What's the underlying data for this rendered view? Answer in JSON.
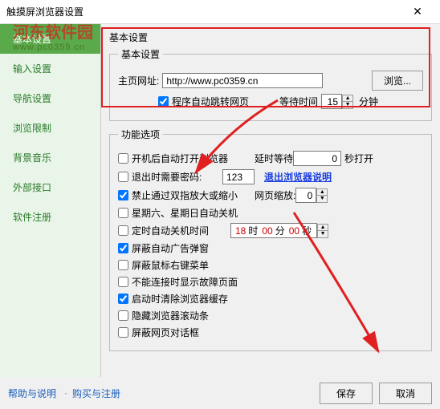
{
  "window": {
    "title": "触摸屏浏览器设置"
  },
  "watermark": {
    "line1": "河东软件园",
    "line2": "www.pc0359.cn"
  },
  "sidebar": {
    "items": [
      {
        "label": "基本设置"
      },
      {
        "label": "输入设置"
      },
      {
        "label": "导航设置"
      },
      {
        "label": "浏览限制"
      },
      {
        "label": "背景音乐"
      },
      {
        "label": "外部接口"
      },
      {
        "label": "软件注册"
      }
    ]
  },
  "basic": {
    "legend_top": "基本设置",
    "legend": "基本设置",
    "homepage_label": "主页网址:",
    "homepage_value": "http://www.pc0359.cn",
    "browse_btn": "浏览...",
    "auto_jump_label": "程序自动跳转网页",
    "auto_jump_checked": true,
    "wait_label": "等待时间",
    "wait_value": "15",
    "wait_unit": "分钟"
  },
  "options": {
    "legend": "功能选项",
    "auto_open": {
      "label": "开机后自动打开浏览器",
      "checked": false
    },
    "delay_label": "延时等待",
    "delay_value": "0",
    "delay_unit": "秒打开",
    "exit_pwd": {
      "label": "退出时需要密码:",
      "checked": false,
      "value": "123"
    },
    "exit_link": "退出浏览器说明",
    "pinch": {
      "label": "禁止通过双指放大或缩小",
      "checked": true
    },
    "zoom_label": "网页缩放:",
    "zoom_value": "0",
    "weekend": {
      "label": "星期六、星期日自动关机",
      "checked": false
    },
    "timed_off": {
      "label": "定时自动关机时间",
      "checked": false
    },
    "time_h": "18",
    "time_h_u": "时",
    "time_m": "00",
    "time_m_u": "分",
    "time_s": "00",
    "time_s_u": "秒",
    "block_popup": {
      "label": "屏蔽自动广告弹窗",
      "checked": true
    },
    "block_rmenu": {
      "label": "屏蔽鼠标右键菜单",
      "checked": false
    },
    "no_error": {
      "label": "不能连接时显示故障页面",
      "checked": false
    },
    "clear_cache": {
      "label": "启动时清除浏览器缓存",
      "checked": true
    },
    "hide_scroll": {
      "label": "隐藏浏览器滚动条",
      "checked": false
    },
    "block_dialog": {
      "label": "屏蔽网页对话框",
      "checked": false
    }
  },
  "footer": {
    "help": "帮助与说明",
    "buy": "购买与注册",
    "save": "保存",
    "cancel": "取消"
  }
}
